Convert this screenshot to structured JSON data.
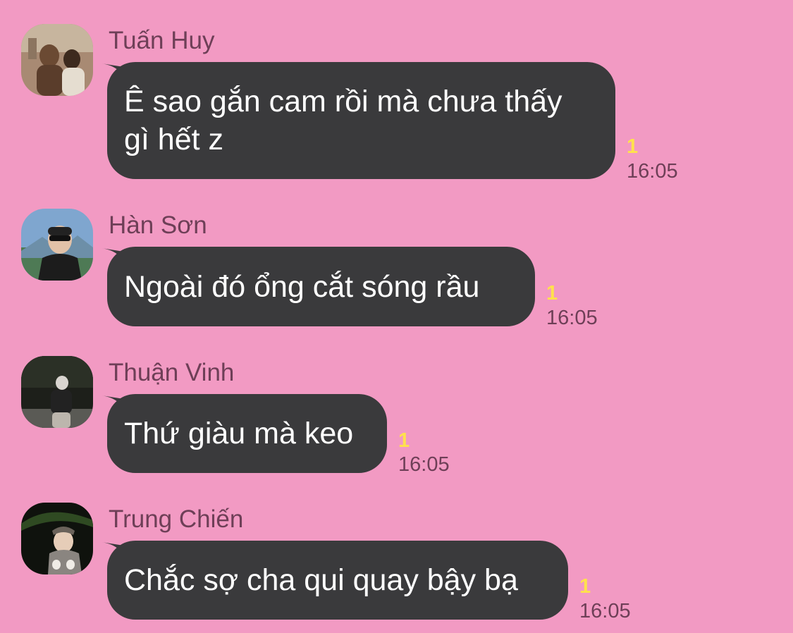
{
  "messages": [
    {
      "sender": "Tuấn Huy",
      "text": "Ê sao gắn cam rồi mà chưa thấy\ngì hết z",
      "unread": "1",
      "time": "16:05",
      "avatar": "avatar-photo"
    },
    {
      "sender": "Hàn Sơn",
      "text": "Ngoài đó ổng cắt sóng rầu",
      "unread": "1",
      "time": "16:05",
      "avatar": "avatar-photo"
    },
    {
      "sender": "Thuận Vinh",
      "text": "Thứ giàu mà keo",
      "unread": "1",
      "time": "16:05",
      "avatar": "avatar-photo"
    },
    {
      "sender": "Trung Chiến",
      "text": "Chắc sợ cha qui quay bậy bạ",
      "unread": "1",
      "time": "16:05",
      "avatar": "avatar-photo"
    }
  ],
  "colors": {
    "background": "#f29ac3",
    "bubble": "#3a3a3c",
    "bubble_text": "#ffffff",
    "sender_name": "#6e3f57",
    "unread_count": "#ffe14d",
    "timestamp": "#6e3f57"
  }
}
